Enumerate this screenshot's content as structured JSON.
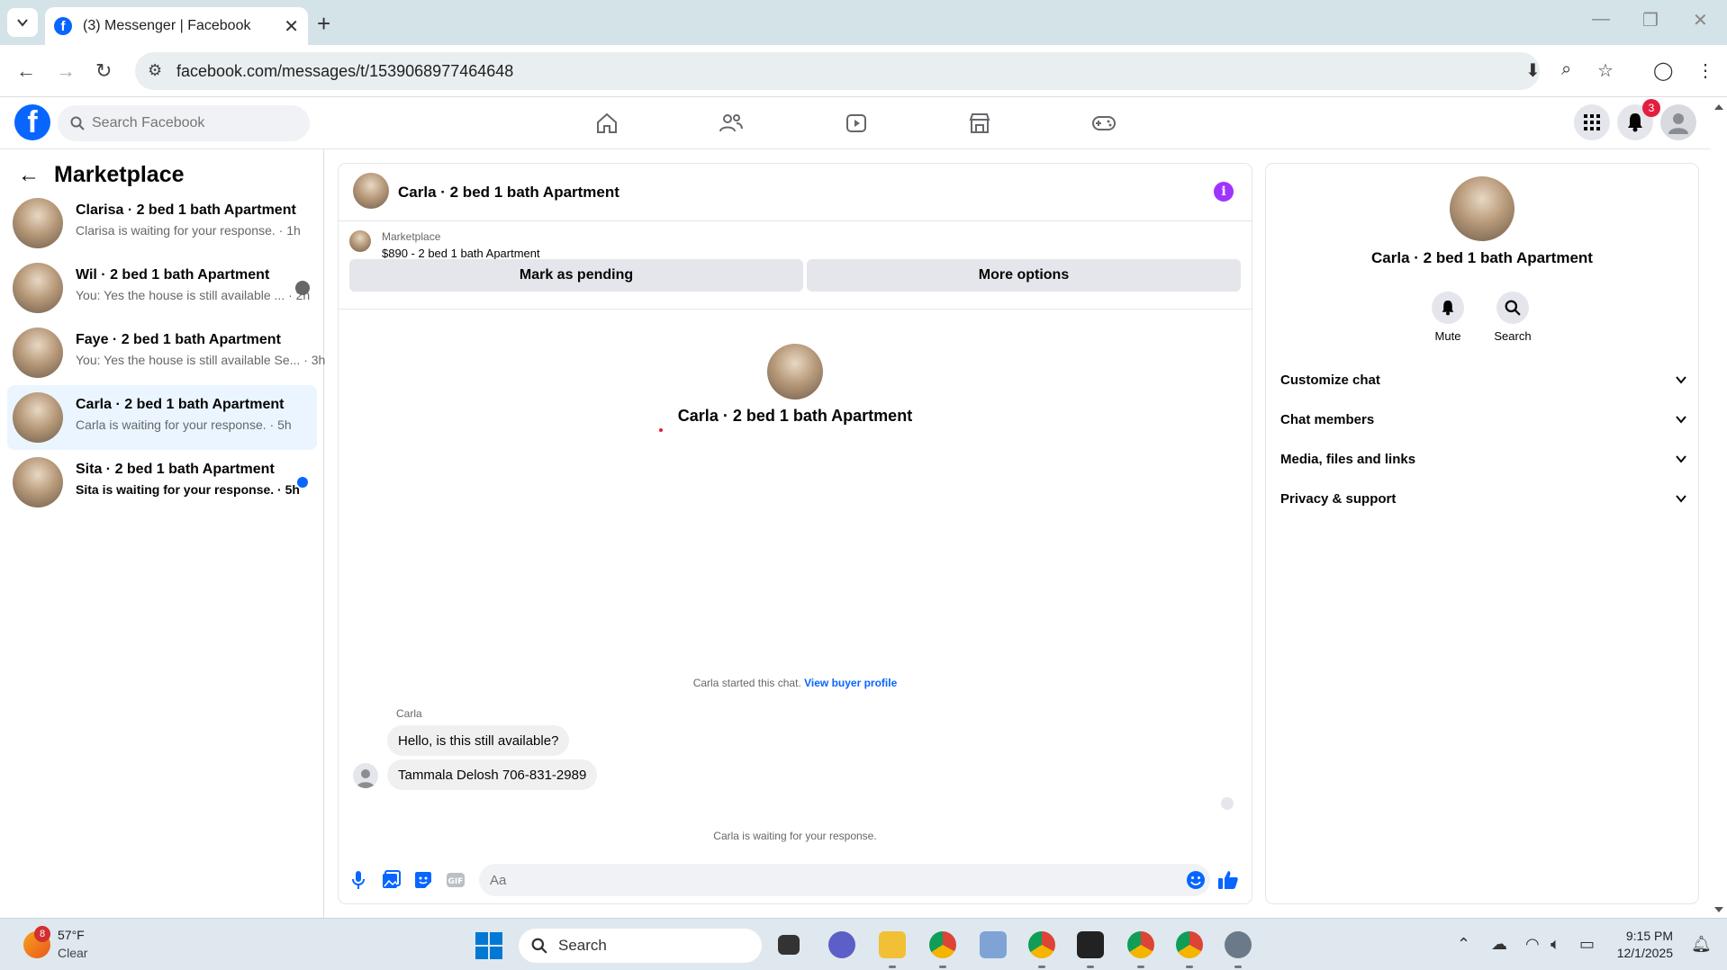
{
  "browser": {
    "tab_title": "(3) Messenger | Facebook",
    "url": "facebook.com/messages/t/1539068977464648"
  },
  "fb_header": {
    "search_placeholder": "Search Facebook",
    "notification_count": "3"
  },
  "left_panel": {
    "title": "Marketplace",
    "conversations": [
      {
        "name": "Clarisa · 2 bed 1 bath Apartment",
        "preview": "Clarisa is waiting for your response. · 1h",
        "unread": false,
        "active": false
      },
      {
        "name": "Wil · 2 bed 1 bath Apartment",
        "preview": "You: Yes the house is still available ... · 2h",
        "unread": false,
        "active": false
      },
      {
        "name": "Faye · 2 bed 1 bath Apartment",
        "preview": "You: Yes the house is still available Se... · 3h",
        "unread": false,
        "active": false
      },
      {
        "name": "Carla · 2 bed 1 bath Apartment",
        "preview": "Carla is waiting for your response. · 5h",
        "unread": false,
        "active": true
      },
      {
        "name": "Sita · 2 bed 1 bath Apartment",
        "preview": "Sita is waiting for your response. · 5h",
        "unread": true,
        "active": false
      }
    ]
  },
  "chat": {
    "title": "Carla · 2 bed 1 bath Apartment",
    "marketplace_label": "Marketplace",
    "listing": "$890 - 2 bed 1 bath Apartment",
    "mark_pending_label": "Mark as pending",
    "more_options_label": "More options",
    "center_name": "Carla · 2 bed 1 bath Apartment",
    "started_text": "Carla started this chat.",
    "view_profile_link": "View buyer profile",
    "sender_name": "Carla",
    "messages": [
      "Hello, is this still available?",
      "Tammala Delosh 706-831-2989"
    ],
    "waiting_text": "Carla is waiting for your response.",
    "input_placeholder": "Aa"
  },
  "right_panel": {
    "name": "Carla · 2 bed 1 bath Apartment",
    "mute_label": "Mute",
    "search_label": "Search",
    "sections": [
      "Customize chat",
      "Chat members",
      "Media, files and links",
      "Privacy & support"
    ]
  },
  "taskbar": {
    "weather_badge": "8",
    "temperature": "57°F",
    "condition": "Clear",
    "search_label": "Search",
    "time": "9:15 PM",
    "date": "12/1/2025"
  },
  "colors": {
    "fb_blue": "#0866ff",
    "info_purple": "#a033ff",
    "active_row": "#ebf5ff"
  }
}
